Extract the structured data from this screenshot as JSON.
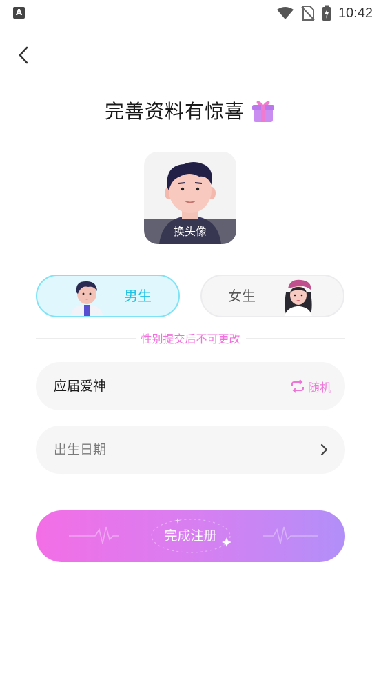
{
  "status_bar": {
    "time": "10:42",
    "app_icon": "A",
    "icons": [
      "wifi-icon",
      "no-sim-icon",
      "battery-charging-icon"
    ]
  },
  "header": {
    "back_icon": "chevron-left-icon",
    "title": "完善资料有惊喜",
    "title_icon": "gift-icon"
  },
  "avatar": {
    "change_label": "换头像"
  },
  "gender": {
    "options": [
      {
        "label": "男生",
        "selected": true,
        "figure_icon": "male-avatar-icon"
      },
      {
        "label": "女生",
        "selected": false,
        "figure_icon": "female-avatar-icon"
      }
    ],
    "note": "性别提交后不可更改"
  },
  "form": {
    "nickname": "应届爱神",
    "random_label": "随机",
    "birth_placeholder": "出生日期"
  },
  "submit_label": "完成注册",
  "colors": {
    "accent_pink": "#f071dc",
    "male_accent": "#1ec1e3",
    "submit_gradient_start": "#f36ee6",
    "submit_gradient_end": "#b28ff8"
  }
}
